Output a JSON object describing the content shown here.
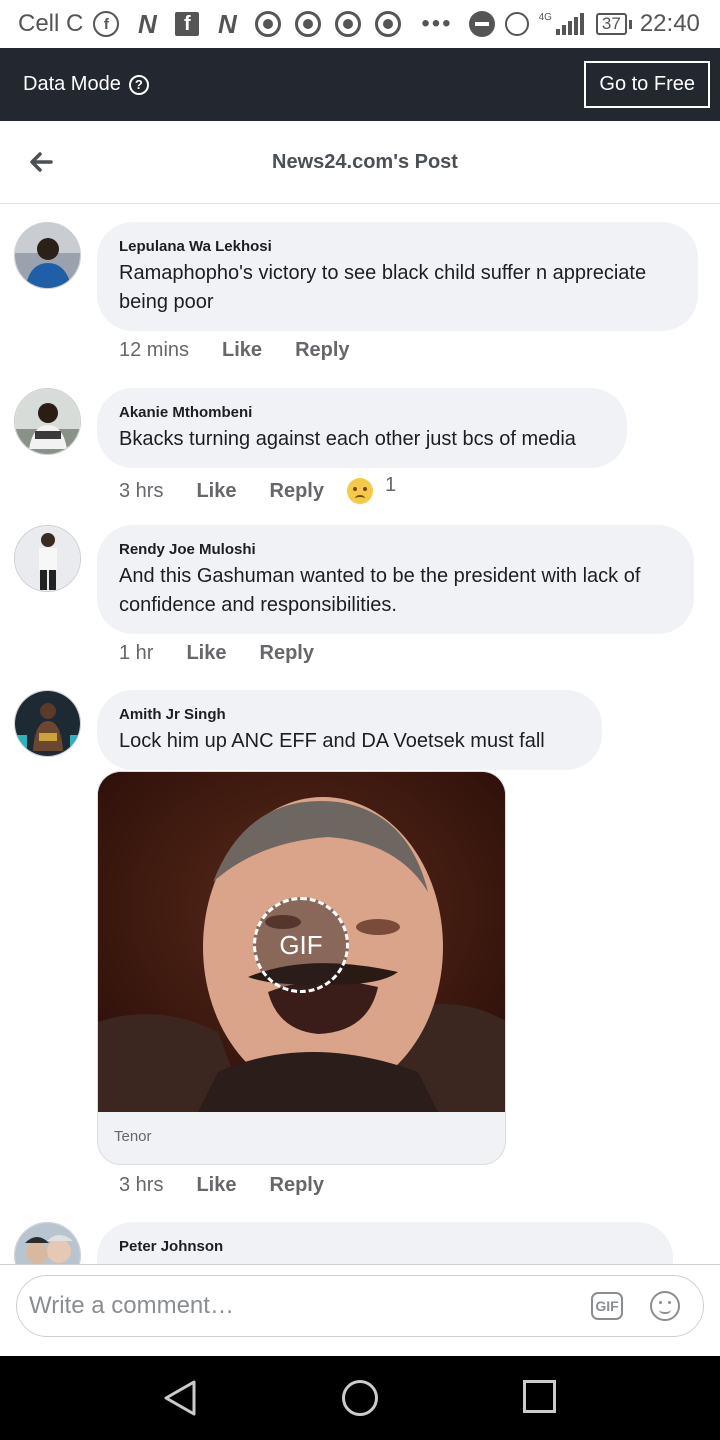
{
  "status_bar": {
    "carrier": "Cell C",
    "notif_letters": [
      "N",
      "f",
      "N"
    ],
    "overflow": "•••",
    "network": "4G",
    "battery": "37",
    "time": "22:40"
  },
  "data_mode": {
    "label": "Data Mode",
    "help_glyph": "?",
    "button_label": "Go to Free"
  },
  "header": {
    "title": "News24.com's Post"
  },
  "comments": [
    {
      "author": "Lepulana Wa Lekhosi",
      "text": "Ramaphopho's victory to see black child suffer n appreciate being poor",
      "time": "12 mins",
      "like": "Like",
      "reply": "Reply"
    },
    {
      "author": "Akanie Mthombeni",
      "text": "Bkacks turning against each other just bcs of media",
      "time": "3 hrs",
      "like": "Like",
      "reply": "Reply",
      "reaction": "sad-face",
      "reaction_count": "1"
    },
    {
      "author": "Rendy Joe Muloshi",
      "text": "And this Gashuman wanted to be the president with lack of confidence and responsibilities.",
      "time": "1 hr",
      "like": "Like",
      "reply": "Reply"
    },
    {
      "author": "Amith Jr Singh",
      "text": "Lock him up   ANC EFF and DA Voetsek  must fall",
      "time": "3 hrs",
      "like": "Like",
      "reply": "Reply",
      "gif_label": "GIF",
      "gif_source": "Tenor"
    },
    {
      "author": "Peter Johnson"
    }
  ],
  "composer": {
    "placeholder": "Write a comment…",
    "gif_label": "GIF"
  },
  "colors": {
    "data_bar": "#23272f",
    "bubble": "#f0f2f5",
    "meta_text": "#65676b"
  }
}
